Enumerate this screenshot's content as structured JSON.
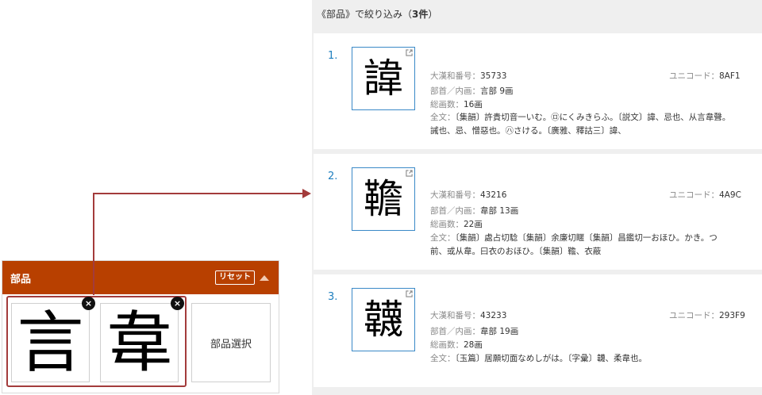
{
  "parts_panel": {
    "title": "部品",
    "reset_label": "リセット",
    "selected_parts": [
      {
        "glyph": "言",
        "remove_label": "×"
      },
      {
        "glyph": "韋",
        "remove_label": "×"
      }
    ],
    "select_button_label": "部品選択"
  },
  "results": {
    "heading_prefix": "《部品》で絞り込み（",
    "heading_count": "3件",
    "heading_suffix": "）",
    "items": [
      {
        "number": "1.",
        "glyph": "諱",
        "daikanwa_label": "大漢和番号：",
        "daikanwa_value": "35733",
        "unicode_label": "ユニコード：",
        "unicode_value": "8AF1",
        "bushu_label": "部首／内画：",
        "bushu_value": "言部 9画",
        "sokaku_label": "総画数：",
        "sokaku_value": "16画",
        "fulltext_label": "全文：",
        "fulltext_line1": "〔集韻〕許貴切⾳⼀いむ。㋺にくみきらふ。〔説文〕諱、忌也、从言韋聲。",
        "fulltext_line2": "誡也、忌、憎惡也。㋩さける。〔廣雅、釋詁三〕諱、"
      },
      {
        "number": "2.",
        "glyph": "韂",
        "daikanwa_label": "大漢和番号：",
        "daikanwa_value": "43216",
        "unicode_label": "ユニコード：",
        "unicode_value": "4A9C",
        "bushu_label": "部首／内画：",
        "bushu_value": "韋部 13画",
        "sokaku_label": "総画数：",
        "sokaku_value": "22画",
        "fulltext_label": "全文：",
        "fulltext_line1": "〔集韻〕處占切騐〔集韻〕余廉切䁥〔集韻〕昌鑑切𨳌⼀おほひ。かき。つ",
        "fulltext_line2": "前、或从韋。⽈衣のおほひ。〔集韻〕韂、衣蔽"
      },
      {
        "number": "3.",
        "glyph": "韤",
        "daikanwa_label": "大漢和番号：",
        "daikanwa_value": "43233",
        "unicode_label": "ユニコード：",
        "unicode_value": "293F9",
        "bushu_label": "部首／内画：",
        "bushu_value": "韋部 19画",
        "sokaku_label": "総画数：",
        "sokaku_value": "28画",
        "fulltext_label": "全文：",
        "fulltext_line1": "〔玉篇〕居願切⾯なめしがは。〔字彙〕韤、柔韋也。",
        "fulltext_line2": ""
      }
    ]
  },
  "colors": {
    "header_brown": "#b84000",
    "highlight_red": "#a33b3b",
    "link_blue": "#1f7fbf"
  },
  "icons": {
    "external_link": "external-link-icon",
    "collapse": "collapse-arrow-icon",
    "remove": "close-icon"
  }
}
